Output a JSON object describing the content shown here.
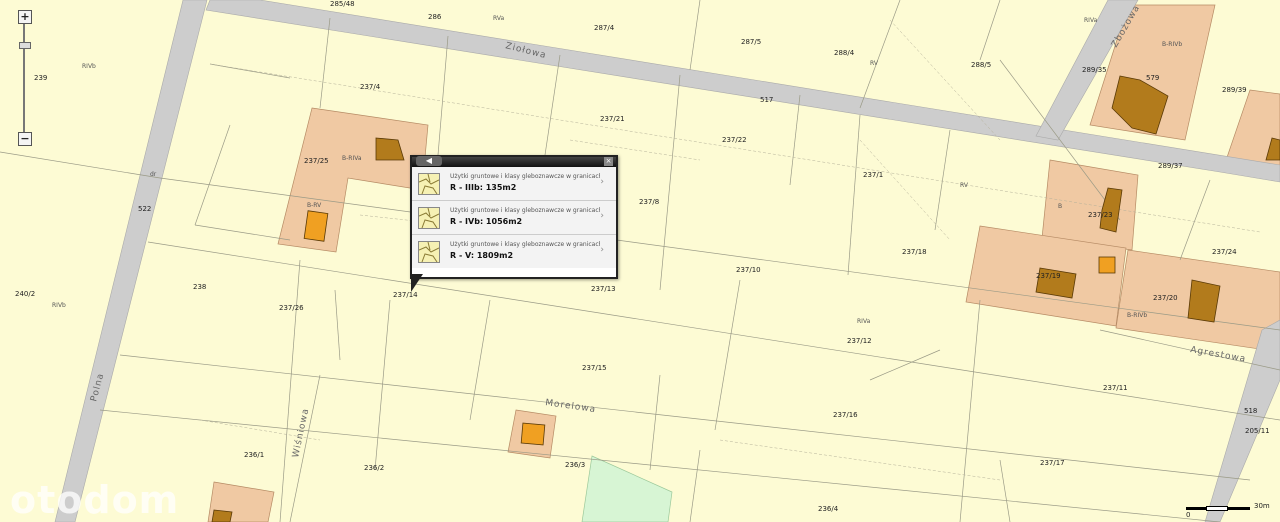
{
  "zoom": {
    "in_label": "+",
    "out_label": "−"
  },
  "roads": [
    {
      "name": "Ziołowa"
    },
    {
      "name": "Agrestowa"
    },
    {
      "name": "Morelowa"
    },
    {
      "name": "Wiśniowa"
    },
    {
      "name": "Polna"
    },
    {
      "name": "Zbożowa"
    }
  ],
  "parcels": [
    "285/48",
    "286",
    "287/4",
    "287/5",
    "288/4",
    "288/5",
    "289/35",
    "579",
    "289/39",
    "289/37",
    "239",
    "237/4",
    "237/21",
    "237/22",
    "517",
    "237/25",
    "237/8",
    "237/1",
    "237/18",
    "237/23",
    "237/24",
    "522",
    "238",
    "237/14",
    "237/13",
    "237/10",
    "237/19",
    "237/20",
    "240/2",
    "237/26",
    "237/15",
    "237/12",
    "237/11",
    "237/16",
    "518",
    "205/11",
    "236/1",
    "236/2",
    "236/3",
    "236/4",
    "237/17"
  ],
  "land_classes": [
    "RIVb",
    "RVa",
    "RIVa",
    "RV",
    "B-RIVa",
    "B-RIVb",
    "B",
    "B-RV",
    "B-RIVb",
    "RIVb",
    "dr",
    "RV",
    "RIVa"
  ],
  "popup": {
    "back_icon": "back-arrow-icon",
    "close_label": "×",
    "items": [
      {
        "caption": "Użytki gruntowe i klasy gleboznawcze w granicach",
        "value": "R - IIIb: 135m2"
      },
      {
        "caption": "Użytki gruntowe i klasy gleboznawcze w granicach",
        "value": "R - IVb: 1056m2"
      },
      {
        "caption": "Użytki gruntowe i klasy gleboznawcze w granicach",
        "value": "R - V: 1809m2"
      }
    ]
  },
  "watermark": "otodom",
  "scale": {
    "start": "0",
    "end": "30m"
  },
  "colors": {
    "ground": "#fdfbd4",
    "built_area": "#f2cdaa",
    "building": "#b27b1c",
    "green": "#d7f5d4",
    "road": "#cccccc"
  }
}
